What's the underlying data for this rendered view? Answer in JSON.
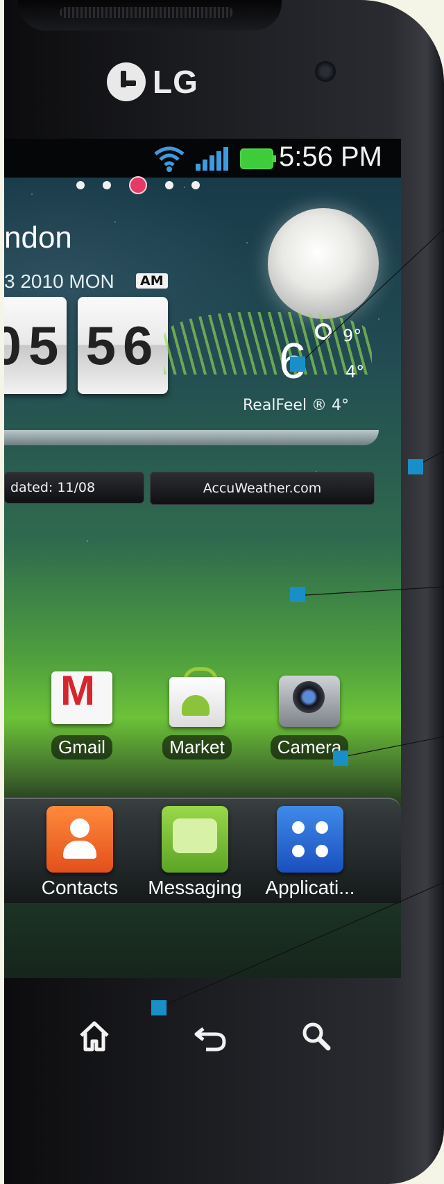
{
  "device": {
    "brand": "LG"
  },
  "status_bar": {
    "time": "5:56 PM"
  },
  "home_pages": {
    "count": 5,
    "active_index": 2
  },
  "weather_widget": {
    "city": "ndon",
    "date": "3 2010 MON",
    "ampm": "AM",
    "hour": "05",
    "minute": "56",
    "temperature": "6",
    "high": "9°",
    "low": "4°",
    "realfeel": "RealFeel ® 4°",
    "updated": "dated: 11/08",
    "provider": "AccuWeather.com"
  },
  "apps": [
    {
      "label": "Gmail",
      "icon": "gmail-icon"
    },
    {
      "label": "Market",
      "icon": "market-icon"
    },
    {
      "label": "Camera",
      "icon": "camera-icon"
    }
  ],
  "dock": [
    {
      "label": "Contacts",
      "icon": "contacts-icon"
    },
    {
      "label": "Messaging",
      "icon": "messaging-icon"
    },
    {
      "label": "Applicati...",
      "icon": "applications-icon"
    }
  ],
  "nav_buttons": [
    "home-icon",
    "back-icon",
    "search-icon"
  ],
  "colors": {
    "callout": "#1a8fc7",
    "battery": "#3ecc3b",
    "signal": "#3d9be0",
    "active_dot": "#e63a66"
  }
}
